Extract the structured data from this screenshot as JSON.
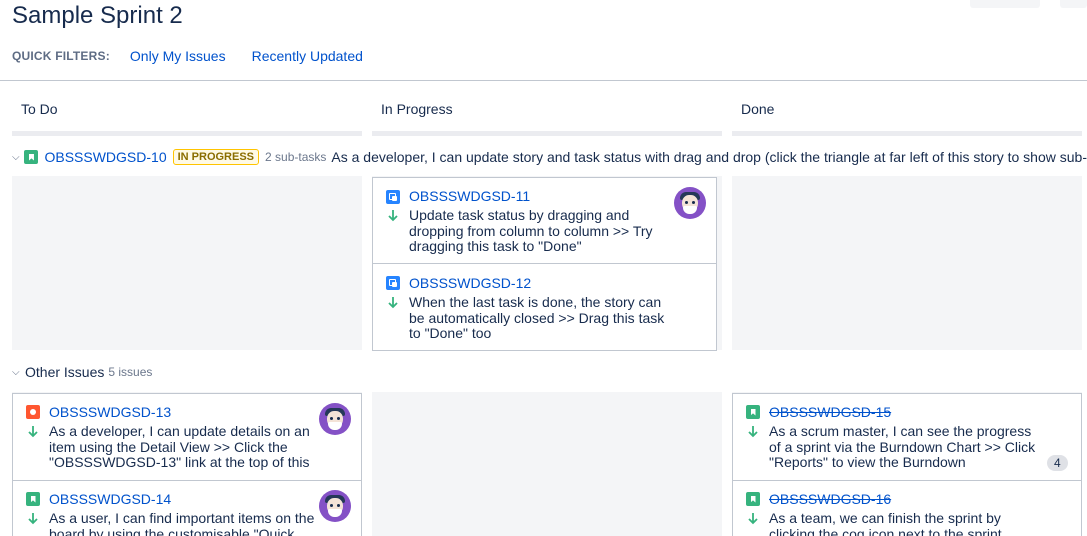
{
  "sprint": {
    "title": "Sample Sprint 2"
  },
  "quick_filters": {
    "label": "QUICK FILTERS:",
    "filters": [
      "Only My Issues",
      "Recently Updated"
    ]
  },
  "columns": [
    "To Do",
    "In Progress",
    "Done"
  ],
  "swimlane": {
    "key": "OBSSSWDGSD-10",
    "status": "IN PROGRESS",
    "subtasks": "2 sub-tasks",
    "summary": "As a developer, I can update story and task status with drag and drop (click the triangle at far left of this story to show sub-"
  },
  "swimlane_cards": [
    {
      "key": "OBSSSWDGSD-11",
      "type": "task-icon",
      "priority": "low",
      "summary": "Update task status by dragging and dropping from column to column >> Try dragging this task to \"Done\""
    },
    {
      "key": "OBSSSWDGSD-12",
      "type": "task-icon",
      "priority": "low",
      "summary": "When the last task is done, the story can be automatically closed >> Drag this task to \"Done\" too"
    }
  ],
  "other_issues": {
    "title": "Other Issues",
    "count": "5 issues",
    "todo": [
      {
        "key": "OBSSSWDGSD-13",
        "type": "bug-icon",
        "priority": "low",
        "summary": "As a developer, I can update details on an item using the Detail View >> Click the \"OBSSSWDGSD-13\" link at the top of this"
      },
      {
        "key": "OBSSSWDGSD-14",
        "type": "story-icon",
        "priority": "low",
        "summary": "As a user, I can find important items on the board by using the customisable \"Quick"
      }
    ],
    "done": [
      {
        "key": "OBSSSWDGSD-15",
        "type": "story-icon",
        "priority": "low",
        "summary": "As a scrum master, I can see the progress of a sprint via the Burndown Chart >> Click \"Reports\" to view the Burndown",
        "badge": "4"
      },
      {
        "key": "OBSSSWDGSD-16",
        "type": "story-icon",
        "priority": "low",
        "summary": "As a team, we can finish the sprint by clicking the cog icon next to the sprint"
      }
    ]
  },
  "colors": {
    "link": "#0052cc",
    "priority_low": "#36b37e",
    "avatar": "#8451c6"
  }
}
